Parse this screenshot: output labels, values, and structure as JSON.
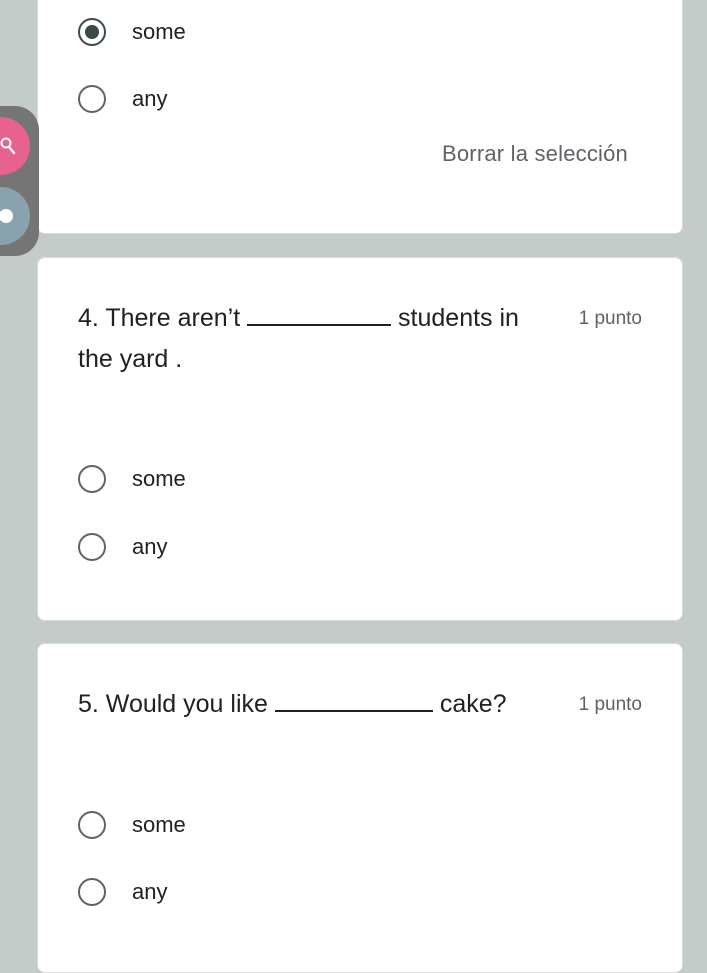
{
  "question3": {
    "options": [
      {
        "label": "some",
        "selected": true
      },
      {
        "label": "any",
        "selected": false
      }
    ],
    "clear_label": "Borrar la selección"
  },
  "question4": {
    "text_before": "4. There aren’t",
    "text_after": "students in the yard .",
    "points": "1 punto",
    "options": [
      {
        "label": "some",
        "selected": false
      },
      {
        "label": "any",
        "selected": false
      }
    ]
  },
  "question5": {
    "text_before": "5. Would you like",
    "text_after": "cake?",
    "points": "1 punto",
    "options": [
      {
        "label": "some",
        "selected": false
      },
      {
        "label": "any",
        "selected": false
      }
    ]
  },
  "toolbar": {
    "icons": [
      "search-icon",
      "settings-icon"
    ],
    "colors": {
      "search": "#e8628f",
      "settings": "#8aa2ad"
    }
  },
  "colors": {
    "background": "#c4ccc9",
    "accent": "#3b4a47"
  }
}
